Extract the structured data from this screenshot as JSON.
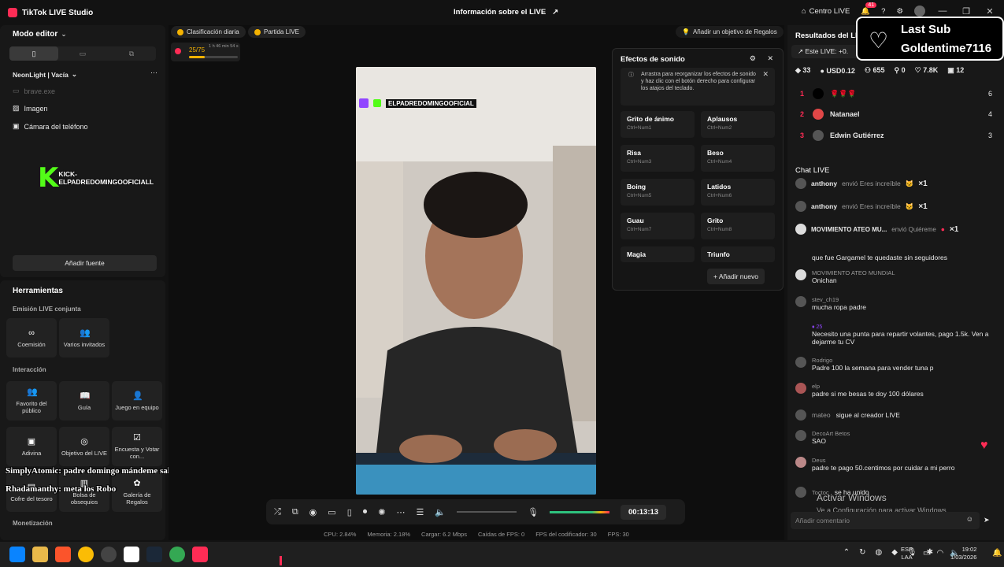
{
  "app": {
    "title": "TikTok LIVE Studio",
    "center_title": "Información sobre el LIVE"
  },
  "header": {
    "centro_live": "Centro LIVE",
    "notif_count": "41"
  },
  "editor": {
    "mode_label": "Modo editor",
    "scene_name": "NeonLight | Vacía",
    "sources": [
      "brave.exe",
      "Imagen",
      "Cámara del teléfono"
    ],
    "add_source": "Añadir fuente",
    "kick_text": "KICK-ELPADREDOMINGOOFICIALL"
  },
  "tools": {
    "title": "Herramientas",
    "section_joint": "Emisión LIVE conjunta",
    "joint": [
      "Coemisión",
      "Varios invitados"
    ],
    "section_interaction": "Interacción",
    "interaction": [
      "Favorito del público",
      "Guía",
      "Juego en equipo",
      "Adivina",
      "Objetivo del LIVE",
      "Encuesta y Votar con...",
      "Cofre del tesoro",
      "Bolsa de obsequios",
      "Galería de Regalos"
    ],
    "section_monetization": "Monetización"
  },
  "stage": {
    "pill_daily": "Clasificación diaria",
    "pill_match": "Partida LIVE",
    "goal_progress": "25/75",
    "goal_timer": "1 h 46 min 54 s",
    "gift_goal": "Añadir un objetivo de Regalos",
    "video_overlay_name": "ELPADREDOMINGOOFICIAL",
    "timer": "00:13:13"
  },
  "sound_effects": {
    "title": "Efectos de sonido",
    "info": "Arrastra para reorganizar los efectos de sonido y haz clic con el botón derecho para configurar los atajos del teclado.",
    "buttons": [
      {
        "name": "Grito de ánimo",
        "key": "Ctrl+Num1"
      },
      {
        "name": "Aplausos",
        "key": "Ctrl+Num2"
      },
      {
        "name": "Risa",
        "key": "Ctrl+Num3"
      },
      {
        "name": "Beso",
        "key": "Ctrl+Num4"
      },
      {
        "name": "Boing",
        "key": "Ctrl+Num5"
      },
      {
        "name": "Latidos",
        "key": "Ctrl+Num6"
      },
      {
        "name": "Guau",
        "key": "Ctrl+Num7"
      },
      {
        "name": "Grito",
        "key": "Ctrl+Num8"
      },
      {
        "name": "Magia",
        "key": ""
      },
      {
        "name": "Triunfo",
        "key": ""
      }
    ],
    "add_new": "Añadir nuevo"
  },
  "results": {
    "title": "Resultados del LI",
    "this_live": "Este LIVE: +0.",
    "stats": [
      "33",
      "USD0.12",
      "655",
      "0",
      "7.8K",
      "12"
    ],
    "ranking": [
      {
        "rank": "1",
        "name": "",
        "score": "6"
      },
      {
        "rank": "2",
        "name": "Natanael",
        "score": "4"
      },
      {
        "rank": "3",
        "name": "Edwin Gutiérrez",
        "score": "3"
      }
    ]
  },
  "last_sub": {
    "label": "Last Sub",
    "user": "Goldentime7116"
  },
  "chat": {
    "title": "Chat LIVE",
    "gifts": [
      {
        "user": "anthony",
        "text": "envió Eres increíble",
        "count": "×1"
      },
      {
        "user": "anthony",
        "text": "envió Eres increíble",
        "count": "×1"
      },
      {
        "user": "MOVIMIENTO ATEO MU...",
        "text": "envió Quiéreme",
        "count": "×1"
      }
    ],
    "messages": [
      {
        "user": "",
        "text": "que fue Gargamel te quedaste sin seguidores"
      },
      {
        "user": "MOVIMIENTO ATEO MUNDIAL",
        "text": "Onichan"
      },
      {
        "user": "stev_ch19",
        "text": "mucha ropa padre"
      },
      {
        "user": "",
        "text": "Necesito una punta para repartir volantes, pago 1.5k. Ven a dejarme tu CV"
      },
      {
        "user": "Rodrigo",
        "text": "Padre 100 la semana para vender tuna p"
      },
      {
        "user": "elp",
        "text": "padre si me besas te doy 100 dólares"
      },
      {
        "user": "mateo",
        "text": "sigue al creador LIVE"
      },
      {
        "user": "DecoArt Betos",
        "text": "SAO"
      },
      {
        "user": "Deus",
        "text": "padre te pago 50.centimos por cuidar a mi perro"
      },
      {
        "user": "Toctoc",
        "text": "se ha unido"
      }
    ],
    "input_placeholder": "Añadir comentario"
  },
  "overlay_chat": [
    "SimplyAtomic: padre domingo mándeme saludo",
    "Rhadamanthy: meta los Robo"
  ],
  "windows_activation": {
    "title": "Activar Windows",
    "subtitle": "Ve a Configuración para activar Windows."
  },
  "status": {
    "cpu": "CPU:  2.84%",
    "memory": "Memoria:  2.18%",
    "upload": "Cargar:  6.2 Mbps",
    "fps_drops": "Caídas de FPS:  0",
    "encoder_fps": "FPS del codificador:  30",
    "fps": "FPS:  30"
  },
  "taskbar": {
    "lang": "ESP",
    "lang2": "LAA",
    "time": "19:02",
    "date": "1/03/2026"
  },
  "colors": {
    "brand": "#fe2c55",
    "accent_green": "#53fc18",
    "background": "#121212"
  }
}
